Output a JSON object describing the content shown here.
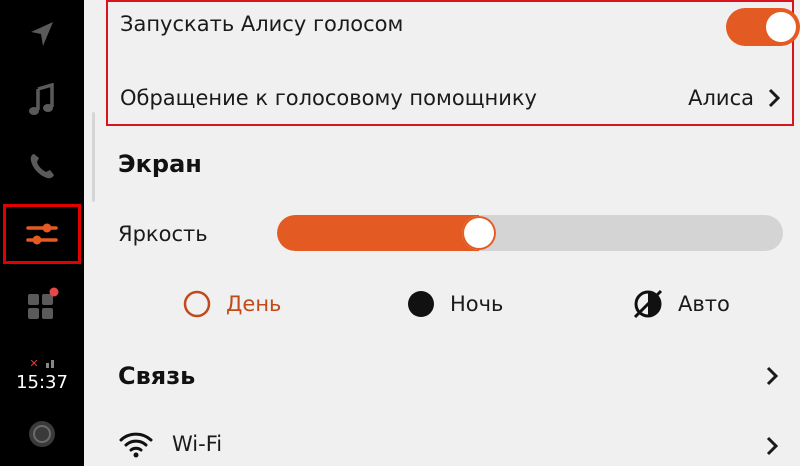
{
  "sidebar": {
    "time": "15:37"
  },
  "voice": {
    "voice_activation_label": "Запускать Алису голосом",
    "voice_activation_enabled": true,
    "assistant_address_label": "Обращение к голосовому помощнику",
    "assistant_address_value": "Алиса"
  },
  "screen": {
    "title": "Экран",
    "brightness_label": "Яркость",
    "brightness_level_percent": 40,
    "modes": [
      {
        "label": "День",
        "selected": true
      },
      {
        "label": "Ночь",
        "selected": false
      },
      {
        "label": "Авто",
        "selected": false
      }
    ]
  },
  "connection": {
    "title": "Связь",
    "wifi_label": "Wi-Fi"
  },
  "colors": {
    "accent": "#e35b22",
    "highlight_border": "#d9141f",
    "sidebar_bg": "#000000",
    "content_bg": "#f0f0f0"
  },
  "icons": [
    "navigation-arrow-icon",
    "music-note-icon",
    "phone-icon",
    "settings-sliders-icon",
    "apps-grid-icon",
    "alice-assistant-icon",
    "chevron-right-icon",
    "wifi-icon",
    "auto-mode-icon"
  ]
}
